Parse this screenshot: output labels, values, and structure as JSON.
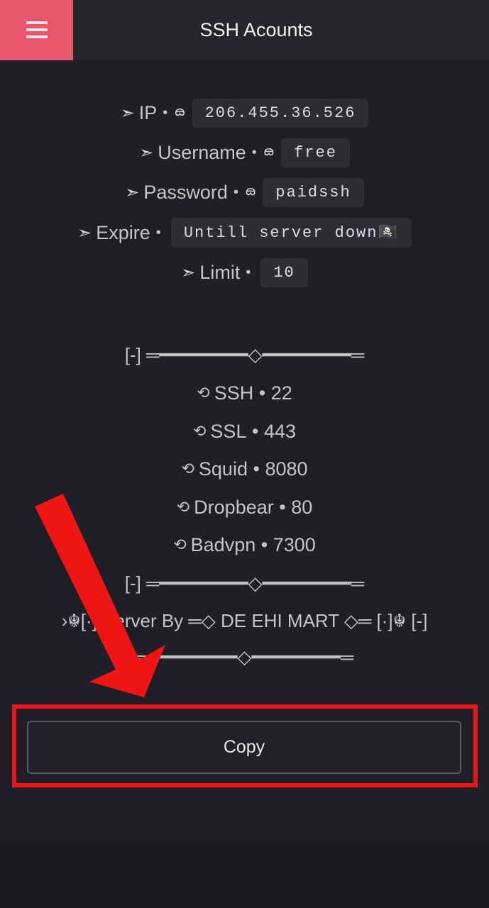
{
  "header": {
    "title": "SSH Acounts",
    "menu_icon": "hamburger-icon"
  },
  "account": {
    "ip": {
      "label": "IP",
      "value": "206.455.36.526"
    },
    "username": {
      "label": "Username",
      "value": "free"
    },
    "password": {
      "label": "Password",
      "value": "paidssh"
    },
    "expire": {
      "label": "Expire",
      "value": "Untill server down🏴‍☠️"
    },
    "limit": {
      "label": "Limit",
      "value": "10"
    }
  },
  "divider_text": "[-] ═━━━━━━━━◇━━━━━━━━═",
  "divider_text_2": "[-] ═━━━━━━━━◇━━━━━━━━═",
  "divider_text_3": "═━━━━━━━━◇━━━━━━━━═",
  "ports": [
    {
      "name": "SSH",
      "port": "22"
    },
    {
      "name": "SSL",
      "port": "443"
    },
    {
      "name": "Squid",
      "port": "8080"
    },
    {
      "name": "Dropbear",
      "port": "80"
    },
    {
      "name": "Badvpn",
      "port": "7300"
    }
  ],
  "footer_line": "›☬[·] Server By ═◇ DE EHI MART ◇═ [·]☬ [-]",
  "copy_button": {
    "label": "Copy"
  },
  "colors": {
    "accent": "#e8566c",
    "highlight": "#f01515",
    "background": "#1e1f27"
  }
}
